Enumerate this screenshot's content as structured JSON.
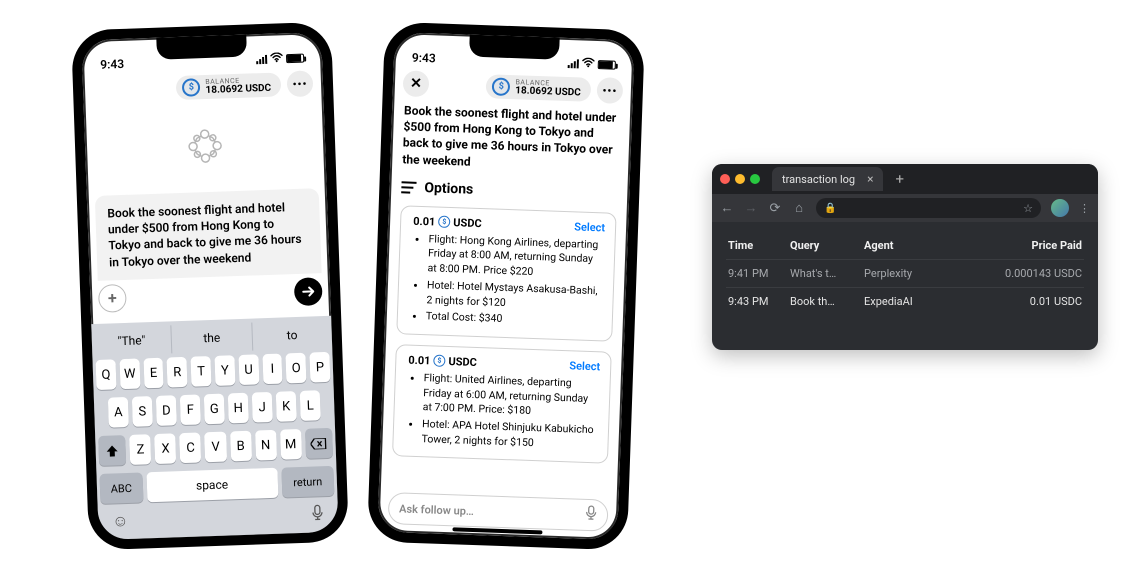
{
  "phone_shared": {
    "status_time": "9:43",
    "balance_label": "BALANCE",
    "balance_value": "18.0692 USDC"
  },
  "phone1": {
    "query_text": "Book the soonest flight and hotel under $500 from Hong Kong to Tokyo and back to give me 36 hours in Tokyo over the weekend",
    "keyboard": {
      "suggestions": [
        "\"The\"",
        "the",
        "to"
      ],
      "row1": [
        "Q",
        "W",
        "E",
        "R",
        "T",
        "Y",
        "U",
        "I",
        "O",
        "P"
      ],
      "row2": [
        "A",
        "S",
        "D",
        "F",
        "G",
        "H",
        "J",
        "K",
        "L"
      ],
      "row3": [
        "Z",
        "X",
        "C",
        "V",
        "B",
        "N",
        "M"
      ],
      "abc": "ABC",
      "space": "space",
      "return": "return"
    }
  },
  "phone2": {
    "query_text": "Book the soonest flight and hotel under $500 from Hong Kong to Tokyo and back to give me 36 hours in Tokyo over the weekend",
    "options_label": "Options",
    "select_label": "Select",
    "options": [
      {
        "price_prefix": "0.01",
        "price_currency": "USDC",
        "bullets": [
          "Flight: Hong Kong Airlines, departing Friday at 8:00 AM, returning Sunday at 8:00 PM. Price $220",
          "Hotel: Hotel Mystays Asakusa-Bashi, 2 nights for $120",
          "Total Cost: $340"
        ]
      },
      {
        "price_prefix": "0.01",
        "price_currency": "USDC",
        "bullets": [
          "Flight: United Airlines, departing Friday at 6:00 AM, returning Sunday at 7:00 PM. Price: $180",
          "Hotel: APA Hotel Shinjuku Kabukicho Tower, 2 nights for $150"
        ]
      }
    ],
    "followup_placeholder": "Ask follow up…"
  },
  "browser": {
    "tab_title": "transaction log",
    "table": {
      "headers": {
        "time": "Time",
        "query": "Query",
        "agent": "Agent",
        "price": "Price Paid"
      },
      "rows": [
        {
          "time": "9:41 PM",
          "query": "What's t…",
          "agent": "Perplexity",
          "price": "0.000143 USDC"
        },
        {
          "time": "9:43 PM",
          "query": "Book th…",
          "agent": "ExpediaAI",
          "price": "0.01 USDC"
        }
      ]
    }
  }
}
